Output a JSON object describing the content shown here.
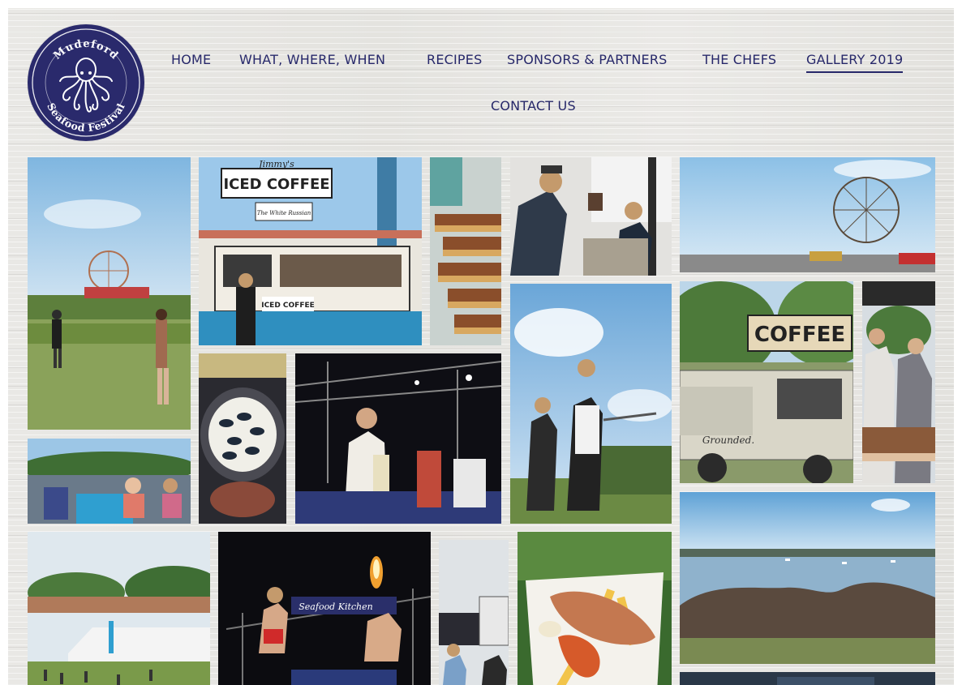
{
  "site": {
    "logo": {
      "text_top": "Mudeford",
      "text_bottom": "Seafood Festival",
      "icon": "octopus-icon",
      "color": "#2a2a6c"
    }
  },
  "nav": {
    "items": [
      {
        "label": "HOME",
        "active": false
      },
      {
        "label": "WHAT, WHERE, WHEN",
        "active": false
      },
      {
        "label": "RECIPES",
        "active": false
      },
      {
        "label": "SPONSORS & PARTNERS",
        "active": false
      },
      {
        "label": "THE CHEFS",
        "active": false
      },
      {
        "label": "GALLERY 2019",
        "active": true
      },
      {
        "label": "CONTACT US",
        "active": false
      }
    ],
    "color": "#27286a"
  },
  "gallery": {
    "photos": [
      {
        "name": "photo-ferris-wheel-field",
        "subject": "visitors walking on grass with ferris wheel"
      },
      {
        "name": "photo-iced-coffee-van",
        "subject": "Jimmy's Iced Coffee van",
        "sign": "ICED COFFEE",
        "brand": "Jimmy's",
        "sub_sign": "The White Russian",
        "counter_sign": "ICED COFFEE"
      },
      {
        "name": "photo-cakes",
        "subject": "tray of caramel slices"
      },
      {
        "name": "photo-bartender",
        "subject": "bartender pouring drinks"
      },
      {
        "name": "photo-ferris-wheel-harbour",
        "subject": "ferris wheel by the harbour"
      },
      {
        "name": "photo-coffee-landrover",
        "subject": "Grounded coffee Land Rover",
        "sign": "COFFEE",
        "brand": "Grounded."
      },
      {
        "name": "photo-cake-stall",
        "subject": "cake stall with customers"
      },
      {
        "name": "photo-juggler",
        "subject": "performer juggling knives"
      },
      {
        "name": "photo-chef-stage",
        "subject": "chef cooking on stage"
      },
      {
        "name": "photo-mussels",
        "subject": "pan of mussels"
      },
      {
        "name": "photo-kids-ride",
        "subject": "children on fairground ride"
      },
      {
        "name": "photo-festival-tents",
        "subject": "festival marquees and crowds"
      },
      {
        "name": "photo-fire-show",
        "subject": "fire performers on stage",
        "sign": "Seafood Kitchen"
      },
      {
        "name": "photo-stall-people",
        "subject": "stall with visitors"
      },
      {
        "name": "photo-prawn-dish",
        "subject": "fish and prawns with chips"
      },
      {
        "name": "photo-harbour-rocks",
        "subject": "harbour view over rocks"
      },
      {
        "name": "photo-bottom-partial",
        "subject": "partially visible photo"
      }
    ]
  }
}
